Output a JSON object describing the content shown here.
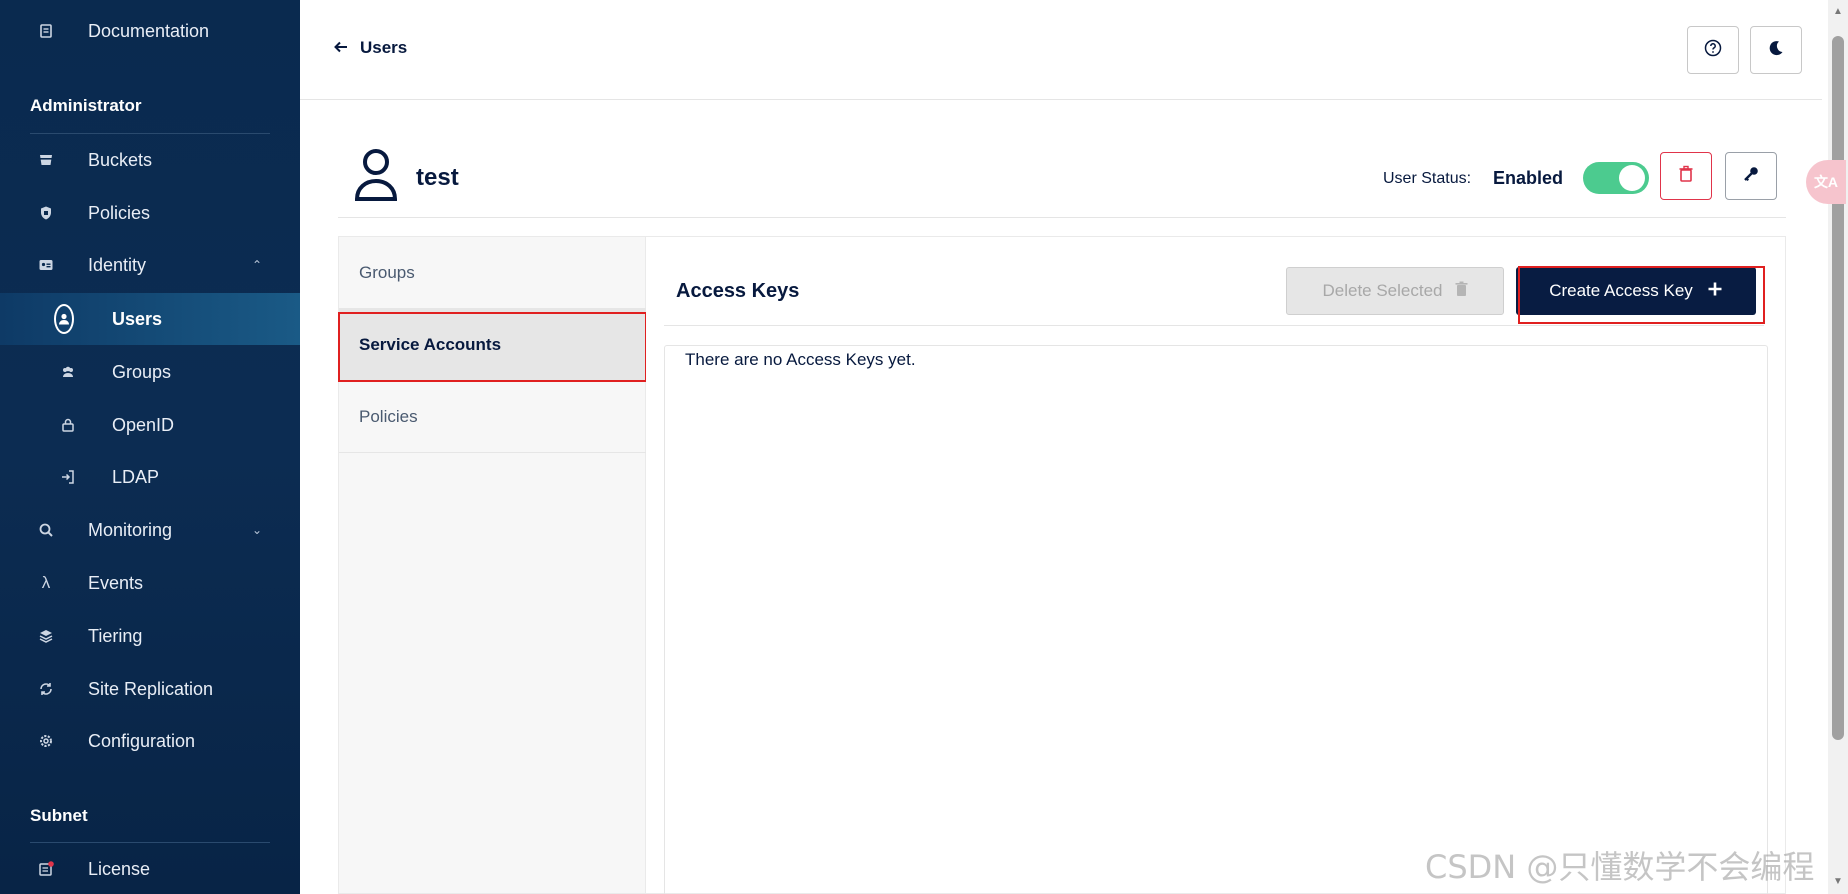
{
  "sidebar": {
    "documentation": "Documentation",
    "admin_title": "Administrator",
    "items": [
      {
        "label": "Buckets"
      },
      {
        "label": "Policies"
      },
      {
        "label": "Identity"
      },
      {
        "label": "Users"
      },
      {
        "label": "Groups"
      },
      {
        "label": "OpenID"
      },
      {
        "label": "LDAP"
      },
      {
        "label": "Monitoring"
      },
      {
        "label": "Events"
      },
      {
        "label": "Tiering"
      },
      {
        "label": "Site Replication"
      },
      {
        "label": "Configuration"
      }
    ],
    "subnet_title": "Subnet",
    "license": "License"
  },
  "header": {
    "back_label": "Users"
  },
  "user": {
    "name": "test",
    "status_label": "User Status:",
    "status_value": "Enabled",
    "status_enabled": true
  },
  "tabs": [
    {
      "label": "Groups"
    },
    {
      "label": "Service Accounts",
      "active": true
    },
    {
      "label": "Policies"
    }
  ],
  "content": {
    "title": "Access Keys",
    "delete_label": "Delete Selected",
    "create_label": "Create Access Key",
    "empty_message": "There are no Access Keys yet."
  },
  "overlay": {
    "translate_badge": "文A",
    "watermark": "CSDN @只懂数学不会编程"
  },
  "colors": {
    "sidebar_bg": "#0a2a4f",
    "primary": "#081c42",
    "toggle_on": "#4ccb8f",
    "danger": "#e02020"
  }
}
